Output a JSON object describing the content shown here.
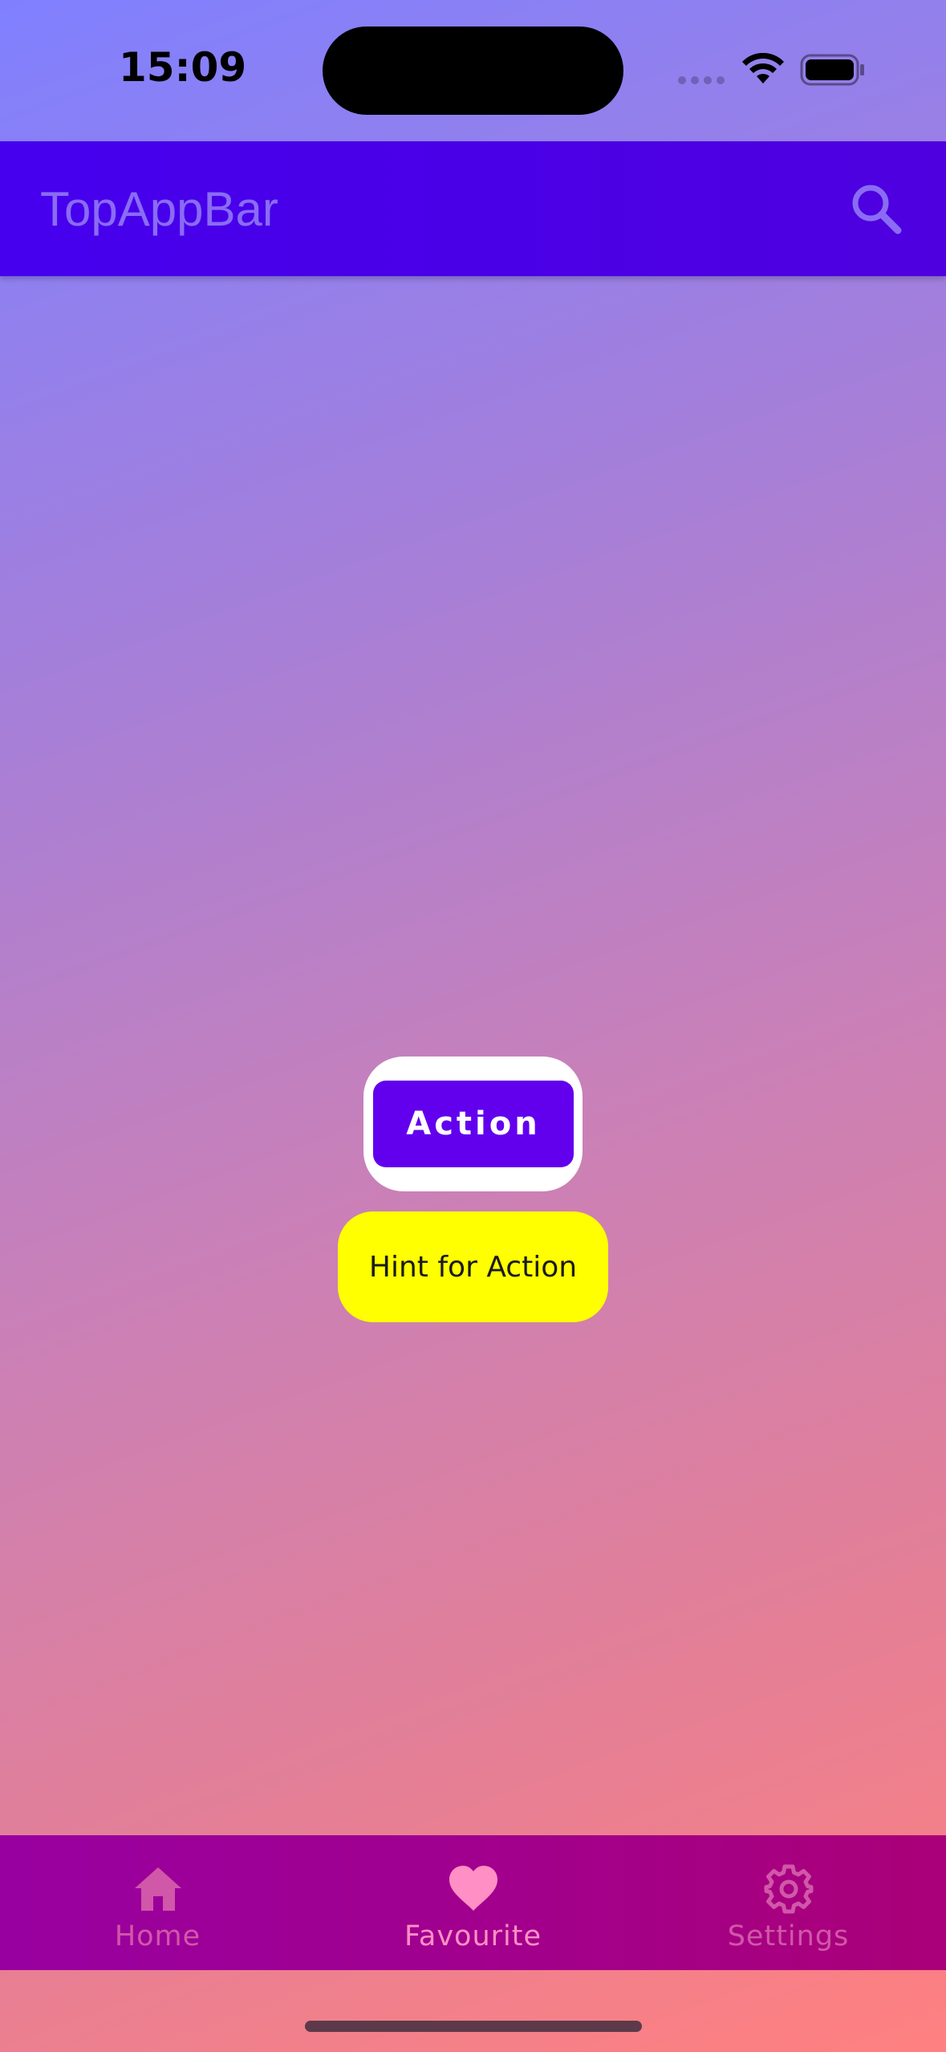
{
  "status_bar": {
    "time": "15:09",
    "icons": [
      "signal-icon",
      "wifi-icon",
      "battery-icon"
    ]
  },
  "top_app_bar": {
    "title": "TopAppBar",
    "actions": [
      {
        "icon": "search-icon"
      }
    ],
    "background_color": "#4600ee"
  },
  "main": {
    "action_button_label": "Action",
    "hint_text": "Hint for Action",
    "action_color": "#6200ee",
    "hint_color": "#ffff00"
  },
  "bottom_nav": {
    "items": [
      {
        "label": "Home",
        "icon": "home-icon",
        "selected": false
      },
      {
        "label": "Favourite",
        "icon": "heart-icon",
        "selected": true
      },
      {
        "label": "Settings",
        "icon": "gear-icon",
        "selected": false
      }
    ],
    "background_color": "#a3008a"
  }
}
